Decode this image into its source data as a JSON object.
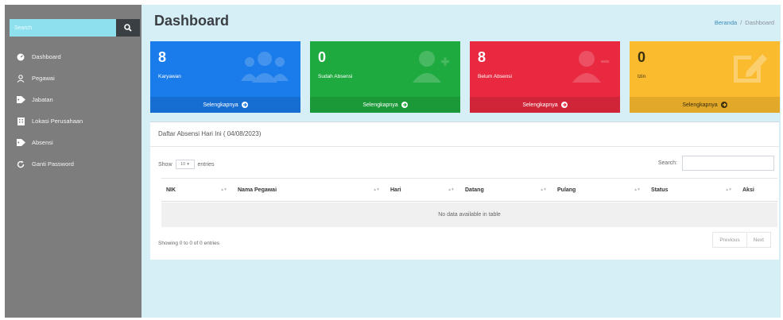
{
  "sidebar": {
    "search_placeholder": "Search",
    "items": [
      {
        "label": "Dashboard",
        "icon": "dashboard-icon"
      },
      {
        "label": "Pegawai",
        "icon": "user-icon"
      },
      {
        "label": "Jabatan",
        "icon": "tag-icon"
      },
      {
        "label": "Lokasi Perusahaan",
        "icon": "building-icon"
      },
      {
        "label": "Absensi",
        "icon": "tag-icon"
      },
      {
        "label": "Ganti Password",
        "icon": "refresh-icon"
      }
    ]
  },
  "header": {
    "title": "Dashboard",
    "breadcrumb": [
      "Beranda",
      "/",
      "Dashboard"
    ]
  },
  "stats": [
    {
      "value": "8",
      "label": "Karyawan",
      "link": "Selengkapnya",
      "color": "#1a7bea",
      "icon": "users-icon"
    },
    {
      "value": "0",
      "label": "Sudah Absensi",
      "link": "Selengkapnya",
      "color": "#1faa3f",
      "icon": "user-plus-icon"
    },
    {
      "value": "8",
      "label": "Belum Absensi",
      "link": "Selengkapnya",
      "color": "#e8293f",
      "icon": "user-minus-icon"
    },
    {
      "value": "0",
      "label": "Izin",
      "link": "Selengkapnya",
      "color": "#fbbb2f",
      "icon": "edit-icon"
    }
  ],
  "table_card": {
    "title": "Daftar Absensi Hari Ini ( 04/08/2023)",
    "show_label": "Show",
    "entries_value": "10",
    "entries_label": "entries",
    "search_label": "Search:",
    "columns": [
      "NIK",
      "Nama Pegawai",
      "Hari",
      "Datang",
      "Pulang",
      "Status",
      "Aksi"
    ],
    "empty_text": "No data available in table",
    "info": "Showing 0 to 0 of 0 entries",
    "prev_label": "Previous",
    "next_label": "Next"
  }
}
